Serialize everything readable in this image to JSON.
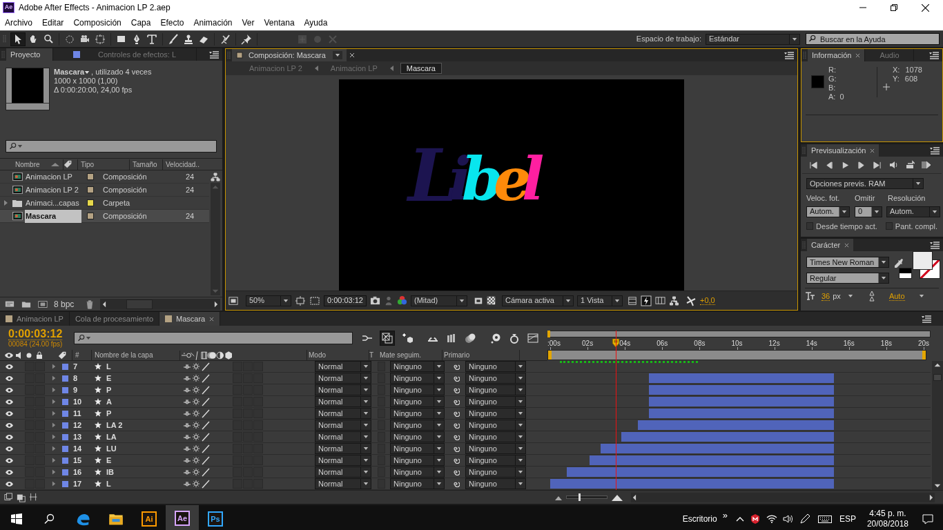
{
  "window": {
    "app_badge": "Ae",
    "title": "Adobe After Effects - Animacion LP 2.aep"
  },
  "menu": [
    "Archivo",
    "Editar",
    "Composición",
    "Capa",
    "Efecto",
    "Animación",
    "Ver",
    "Ventana",
    "Ayuda"
  ],
  "toolbar": {
    "tools": [
      {
        "kind": "selection",
        "selected": true,
        "disabled": false
      },
      {
        "kind": "hand",
        "selected": false,
        "disabled": false
      },
      {
        "kind": "zoom",
        "selected": false,
        "disabled": false
      },
      {
        "kind": "rotation",
        "selected": false,
        "disabled": false
      },
      {
        "kind": "camera",
        "selected": false,
        "disabled": false
      },
      {
        "kind": "pan",
        "selected": false,
        "disabled": false
      },
      {
        "kind": "rectangle",
        "selected": false,
        "disabled": false
      },
      {
        "kind": "pen",
        "selected": false,
        "disabled": false
      },
      {
        "kind": "type",
        "selected": false,
        "disabled": false
      },
      {
        "kind": "brush",
        "selected": false,
        "disabled": false
      },
      {
        "kind": "stamp",
        "selected": false,
        "disabled": false
      },
      {
        "kind": "eraser",
        "selected": false,
        "disabled": false
      },
      {
        "kind": "roto",
        "selected": false,
        "disabled": false
      },
      {
        "kind": "pin",
        "selected": false,
        "disabled": false
      },
      {
        "kind": "axis",
        "selected": false,
        "disabled": true
      },
      {
        "kind": "dot",
        "selected": false,
        "disabled": true
      },
      {
        "kind": "view",
        "selected": false,
        "disabled": true
      }
    ],
    "workspace_label": "Espacio de trabajo:",
    "workspace": "Estándar",
    "search_placeholder": "Buscar en la Ayuda"
  },
  "project_panel": {
    "tabs": [
      {
        "label": "Proyecto",
        "selected": true
      },
      {
        "label": "Controles de efectos: L",
        "selected": false
      }
    ],
    "item_name": "Mascara",
    "item_usage": ", utilizado 4 veces",
    "item_size": "1000 x 1000 (1,00)",
    "item_duration": "Δ 0:00:20:00, 24,00 fps",
    "columns": [
      "Nombre",
      "Tipo",
      "Tamaño",
      "Velocidad.."
    ],
    "items": [
      {
        "kind": "composition",
        "name": "Animacion LP",
        "color": "#b4a283",
        "type": "Composición",
        "rate": "24",
        "selected": false
      },
      {
        "kind": "composition",
        "name": "Animacion LP 2",
        "color": "#b4a283",
        "type": "Composición",
        "rate": "24",
        "selected": false
      },
      {
        "kind": "folder",
        "name": "Animaci...capas",
        "color": "#e6d84b",
        "type": "Carpeta",
        "expanded": false,
        "selected": false
      },
      {
        "kind": "composition",
        "name": "Mascara",
        "color": "#b4a283",
        "type": "Composición",
        "rate": "24",
        "selected": true
      }
    ],
    "bit_depth": "8 bpc"
  },
  "composition_panel": {
    "tab": "Composición: Mascara",
    "breadcrumbs": [
      {
        "label": "Animacion LP 2",
        "selected": false
      },
      {
        "label": "Animacion LP",
        "selected": false
      },
      {
        "label": "Mascara",
        "selected": true
      }
    ],
    "letters": [
      {
        "char": "L",
        "color": "#1c1450"
      },
      {
        "char": "i",
        "color": "#1c1450"
      },
      {
        "char": "b",
        "color": "#08e6ee"
      },
      {
        "char": "e",
        "color": "#ff8a0a"
      },
      {
        "char": "l",
        "color": "#ff1fa0"
      }
    ],
    "zoom": "50%",
    "timecode": "0:00:03:12",
    "resolution": "(Mitad)",
    "camera": "Cámara activa",
    "views": "1 Vista",
    "exposure": "+0,0"
  },
  "info_panel": {
    "tabs": [
      {
        "label": "Información",
        "selected": true
      },
      {
        "label": "Audio",
        "selected": false
      }
    ],
    "channels": [
      "R:",
      "G:",
      "B:",
      "A:"
    ],
    "alpha_value": "0",
    "x_label": "X:",
    "x_value": "1078",
    "y_label": "Y:",
    "y_value": "608"
  },
  "preview_panel": {
    "tab": "Previsualización",
    "options": "Opciones previs. RAM",
    "frame_rate_label": "Veloc. fot.",
    "frame_rate": "Autom.",
    "skip_label": "Omitir",
    "skip": "0",
    "resolution_label": "Resolución",
    "resolution": "Autom.",
    "checkboxes": [
      {
        "label": "Desde tiempo act.",
        "checked": false
      },
      {
        "label": "Pant. compl.",
        "checked": false
      }
    ]
  },
  "character_panel": {
    "tab": "Carácter",
    "font": "Times New Roman",
    "style": "Regular",
    "size": "36",
    "size_unit": "px",
    "leading": "Auto"
  },
  "timeline": {
    "tabs": [
      {
        "label": "Animacion LP",
        "selected": false
      },
      {
        "label": "Cola de procesamiento",
        "selected": false
      },
      {
        "label": "Mascara",
        "selected": true
      }
    ],
    "current_time": "0:00:03:12",
    "frame_info": "00084 (24.00 fps)",
    "columns": {
      "number": "#",
      "name": "Nombre de la capa",
      "mode": "Modo",
      "t": "T",
      "matte": "Mate seguim.",
      "parent": "Primario"
    },
    "ruler": [
      ":00s",
      "02s",
      "04s",
      "06s",
      "08s",
      "10s",
      "12s",
      "14s",
      "16s",
      "18s",
      "20s"
    ],
    "layers": [
      {
        "number": "7",
        "name": "L",
        "visible": true,
        "color": "#6f86e6",
        "mode": "Normal",
        "matte": "Ninguno",
        "parent": "Ninguno"
      },
      {
        "number": "8",
        "name": "E",
        "visible": true,
        "color": "#6f86e6",
        "mode": "Normal",
        "matte": "Ninguno",
        "parent": "Ninguno"
      },
      {
        "number": "9",
        "name": "P",
        "visible": true,
        "color": "#6f86e6",
        "mode": "Normal",
        "matte": "Ninguno",
        "parent": "Ninguno"
      },
      {
        "number": "10",
        "name": "A",
        "visible": true,
        "color": "#6f86e6",
        "mode": "Normal",
        "matte": "Ninguno",
        "parent": "Ninguno"
      },
      {
        "number": "11",
        "name": "P",
        "visible": true,
        "color": "#6f86e6",
        "mode": "Normal",
        "matte": "Ninguno",
        "parent": "Ninguno"
      },
      {
        "number": "12",
        "name": "LA 2",
        "visible": true,
        "color": "#6f86e6",
        "mode": "Normal",
        "matte": "Ninguno",
        "parent": "Ninguno"
      },
      {
        "number": "13",
        "name": "LA",
        "visible": true,
        "color": "#6f86e6",
        "mode": "Normal",
        "matte": "Ninguno",
        "parent": "Ninguno"
      },
      {
        "number": "14",
        "name": "LU",
        "visible": true,
        "color": "#6f86e6",
        "mode": "Normal",
        "matte": "Ninguno",
        "parent": "Ninguno"
      },
      {
        "number": "15",
        "name": "E",
        "visible": true,
        "color": "#6f86e6",
        "mode": "Normal",
        "matte": "Ninguno",
        "parent": "Ninguno"
      },
      {
        "number": "16",
        "name": "IB",
        "visible": true,
        "color": "#6f86e6",
        "mode": "Normal",
        "matte": "Ninguno",
        "parent": "Ninguno"
      },
      {
        "number": "17",
        "name": "L",
        "visible": true,
        "color": "#6f86e6",
        "mode": "Normal",
        "matte": "Ninguno",
        "parent": "Ninguno"
      }
    ],
    "zoom_slider": {
      "level": 0.3
    }
  },
  "taskbar": {
    "apps": [
      {
        "kind": "edge",
        "selected": false
      },
      {
        "kind": "explorer",
        "selected": false
      },
      {
        "kind": "badge",
        "label": "Ai",
        "color": "#ff9a00",
        "selected": false
      },
      {
        "kind": "badge",
        "label": "Ae",
        "color": "#d7a6ff",
        "selected": true
      },
      {
        "kind": "badge",
        "label": "Ps",
        "color": "#31a8ff",
        "selected": false
      }
    ],
    "desktop": "Escritorio",
    "chevron": "»",
    "language": "ESP",
    "time": "4:45 p. m.",
    "date": "20/08/2018"
  }
}
